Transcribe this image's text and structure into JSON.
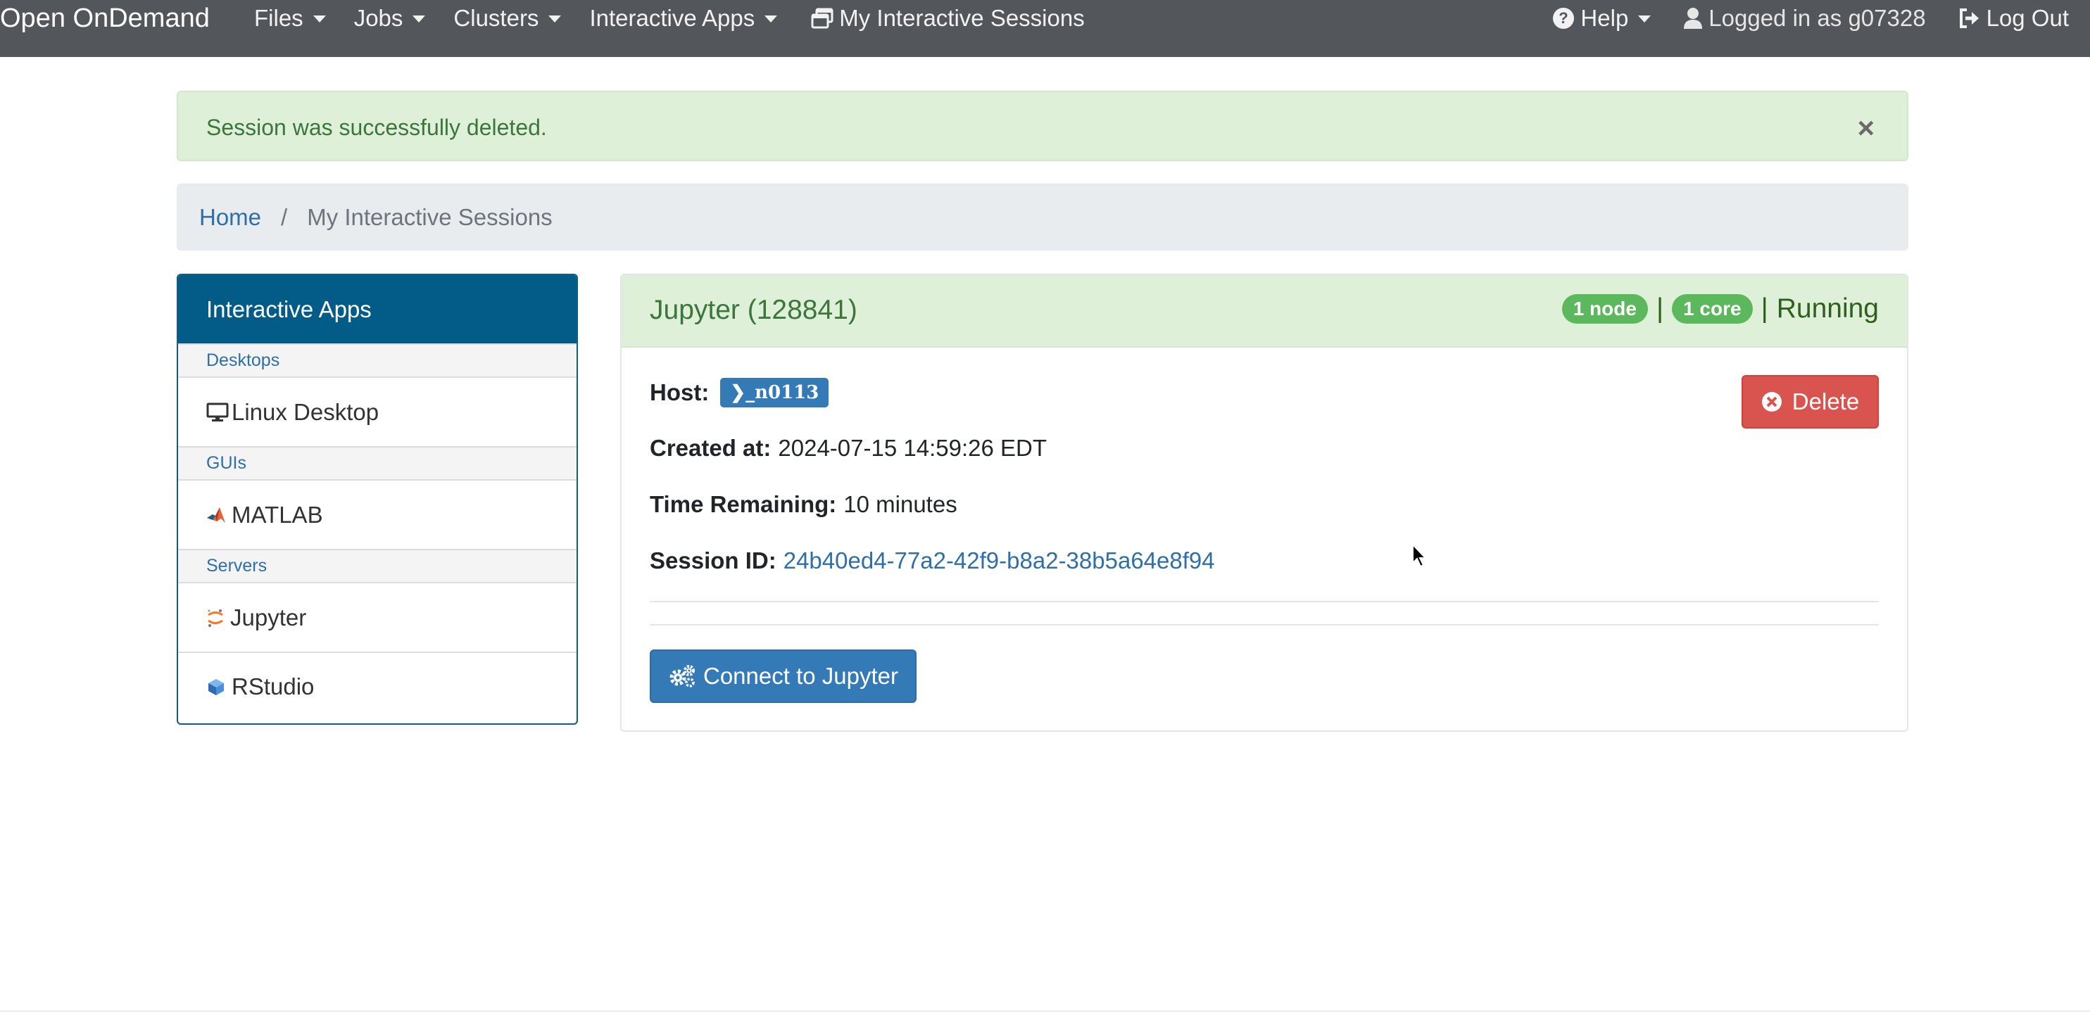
{
  "navbar": {
    "brand": "Open OnDemand",
    "menus": [
      "Files",
      "Jobs",
      "Clusters",
      "Interactive Apps"
    ],
    "sessions_link": "My Interactive Sessions",
    "help": "Help",
    "logged_in": "Logged in as g07328",
    "logout": "Log Out"
  },
  "alert": {
    "message": "Session was successfully deleted.",
    "close": "×"
  },
  "breadcrumb": {
    "home": "Home",
    "separator": "/",
    "current": "My Interactive Sessions"
  },
  "sidebar": {
    "title": "Interactive Apps",
    "categories": [
      {
        "name": "Desktops",
        "items": [
          {
            "label": "Linux Desktop",
            "icon": "monitor-icon"
          }
        ]
      },
      {
        "name": "GUIs",
        "items": [
          {
            "label": "MATLAB",
            "icon": "matlab-icon"
          }
        ]
      },
      {
        "name": "Servers",
        "items": [
          {
            "label": "Jupyter",
            "icon": "jupyter-icon"
          },
          {
            "label": "RStudio",
            "icon": "rstudio-icon"
          }
        ]
      }
    ]
  },
  "session": {
    "title": "Jupyter (128841)",
    "nodes": "1 node",
    "separator": "|",
    "cores": "1 core",
    "status": "Running",
    "host_label": "Host:",
    "host": "n0113",
    "created_label": "Created at:",
    "created": "2024-07-15 14:59:26 EDT",
    "remaining_label": "Time Remaining:",
    "remaining": "10 minutes",
    "id_label": "Session ID:",
    "id": "24b40ed4-77a2-42f9-b8a2-38b5a64e8f94",
    "delete": "Delete",
    "connect": "Connect to Jupyter"
  },
  "colors": {
    "navbar": "#53565a",
    "sidebar_header": "#035c87",
    "success_bg": "#dff0d8",
    "danger": "#d9534f",
    "primary": "#337ab7",
    "badge_green": "#5cb85c"
  }
}
